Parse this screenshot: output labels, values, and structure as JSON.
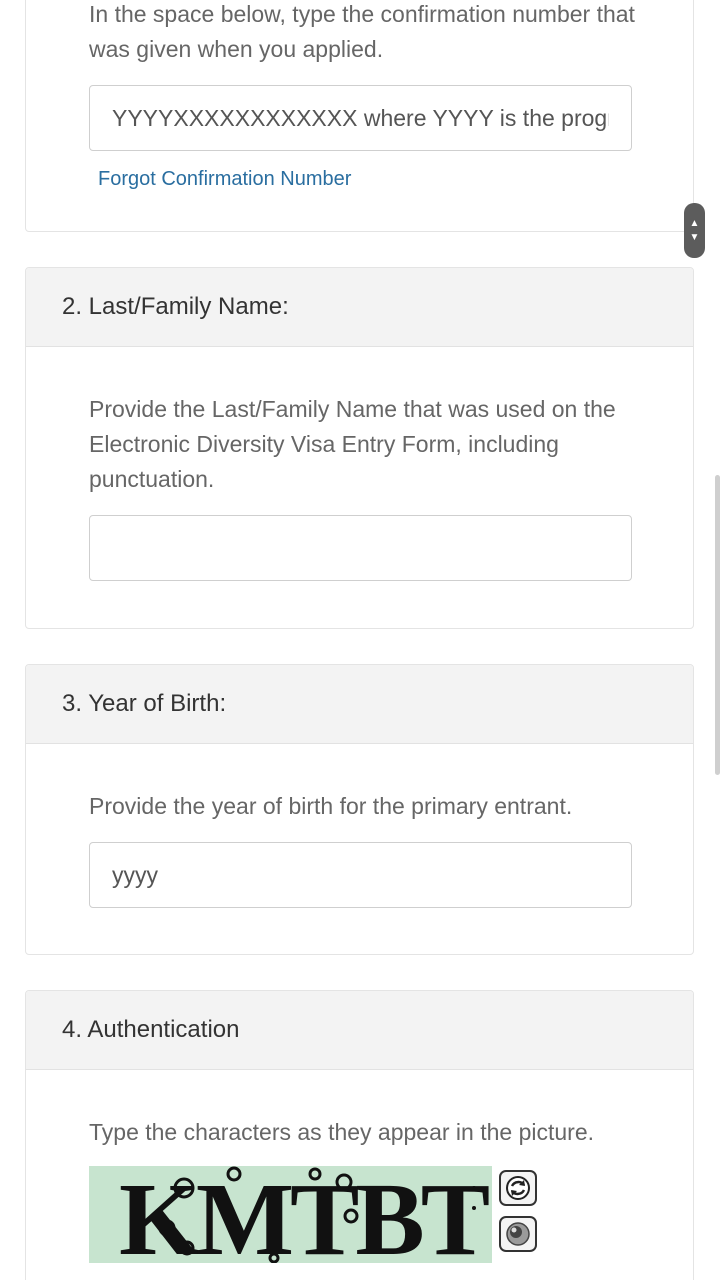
{
  "section1": {
    "description": "In the space below, type the confirmation number that was given when you applied.",
    "confirmation_placeholder": "YYYYXXXXXXXXXXXX where YYYY is the program year",
    "forgot_link": "Forgot Confirmation Number"
  },
  "section2": {
    "heading": "2. Last/Family Name:",
    "description": "Provide the Last/Family Name that was used on the Electronic Diversity Visa Entry Form, including punctuation.",
    "last_name_value": ""
  },
  "section3": {
    "heading": "3. Year of Birth:",
    "description": "Provide the year of birth for the primary entrant.",
    "year_placeholder": "yyyy"
  },
  "section4": {
    "heading": "4. Authentication",
    "description": "Type the characters as they appear in the picture.",
    "captcha_text": "KMTBT"
  },
  "icons": {
    "scroll_handle": "scroll-up-down-icon",
    "captcha_refresh": "refresh-icon",
    "captcha_audio": "speaker-icon"
  }
}
